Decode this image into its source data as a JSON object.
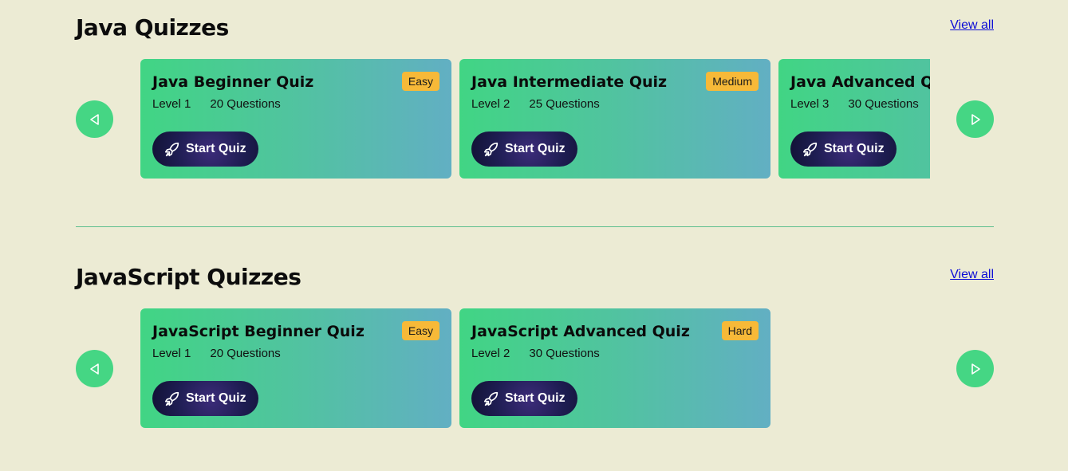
{
  "sections": [
    {
      "title": "Java Quizzes",
      "view_all": "View all",
      "cards": [
        {
          "title": "Java Beginner Quiz",
          "badge": "Easy",
          "level": "Level 1",
          "questions": "20 Questions",
          "button": "Start Quiz"
        },
        {
          "title": "Java Intermediate Quiz",
          "badge": "Medium",
          "level": "Level 2",
          "questions": "25 Questions",
          "button": "Start Quiz"
        },
        {
          "title": "Java Advanced Quiz",
          "badge": "",
          "level": "Level 3",
          "questions": "30 Questions",
          "button": "Start Quiz"
        }
      ]
    },
    {
      "title": "JavaScript Quizzes",
      "view_all": "View all",
      "cards": [
        {
          "title": "JavaScript Beginner Quiz",
          "badge": "Easy",
          "level": "Level 1",
          "questions": "20 Questions",
          "button": "Start Quiz"
        },
        {
          "title": "JavaScript Advanced Quiz",
          "badge": "Hard",
          "level": "Level 2",
          "questions": "30 Questions",
          "button": "Start Quiz"
        }
      ]
    }
  ],
  "icons": {
    "prev": "triangle-left-icon",
    "next": "triangle-right-icon",
    "start": "rocket-icon"
  },
  "colors": {
    "background": "#ecebd4",
    "nav_button": "#45d684",
    "badge": "#f7b938",
    "card_gradient_start": "#41d584",
    "card_gradient_end": "#62afc3",
    "start_button": "#1e1d52",
    "divider": "#5fbf8f",
    "link": "#0b0bd6"
  }
}
